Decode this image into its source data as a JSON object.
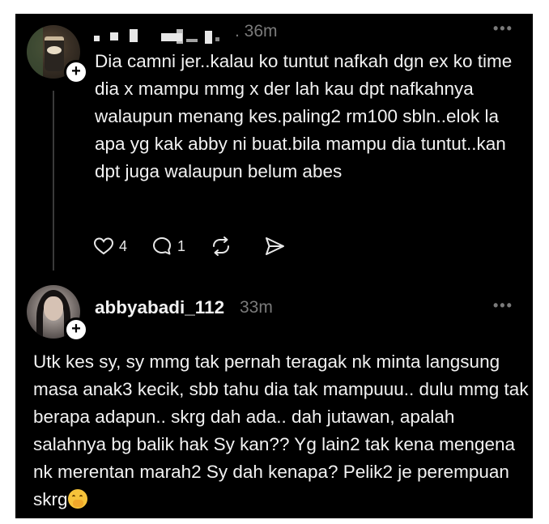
{
  "post1": {
    "timestamp": ". 36m",
    "body": "Dia camni jer..kalau ko tuntut nafkah dgn ex ko time dia x mampu mmg x der lah kau dpt nafkahnya walaupun menang kes.paling2 rm100 sbln..elok la apa yg kak abby ni buat.bila mampu dia tuntut..kan dpt juga walaupun belum abes",
    "likes": "4",
    "replies": "1",
    "more": "•••"
  },
  "post2": {
    "username": "abbyabadi_112",
    "timestamp": "33m",
    "body": "Utk kes sy, sy mmg tak pernah teragak nk minta langsung masa anak3 kecik, sbb tahu dia tak mampuuu.. dulu mmg tak berapa adapun.. skrg dah ada.. dah jutawan, apalah salahnya bg balik hak Sy kan?? Yg lain2 tak kena mengena nk merentan marah2 Sy dah kenapa? Pelik2 je perempuan skrg",
    "more": "•••"
  },
  "icons": {
    "plus": "+",
    "heart": "heart-icon",
    "reply": "comment-icon",
    "repost": "repost-icon",
    "share": "send-icon",
    "emoji": "face-with-hand-over-mouth"
  },
  "colors": {
    "background": "#000000",
    "text": "#f2f2f2",
    "muted": "#7a7a7a"
  }
}
